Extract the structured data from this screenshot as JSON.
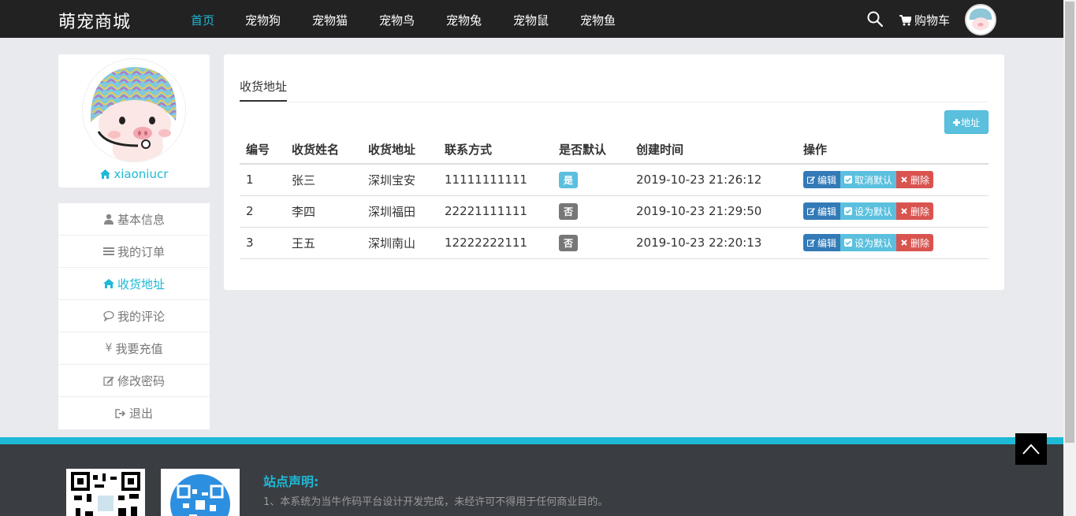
{
  "navbar": {
    "brand": "萌宠商城",
    "items": [
      "首页",
      "宠物狗",
      "宠物猫",
      "宠物鸟",
      "宠物兔",
      "宠物鼠",
      "宠物鱼"
    ],
    "cart_label": "购物车"
  },
  "profile": {
    "username": "xiaoniucr"
  },
  "side_menu": [
    {
      "label": "基本信息",
      "icon": "user-icon"
    },
    {
      "label": "我的订单",
      "icon": "list-icon"
    },
    {
      "label": "收货地址",
      "icon": "home-icon"
    },
    {
      "label": "我的评论",
      "icon": "comment-icon"
    },
    {
      "label": "我要充值",
      "icon": "yen-icon"
    },
    {
      "label": "修改密码",
      "icon": "edit-icon"
    },
    {
      "label": "退出",
      "icon": "signout-icon"
    }
  ],
  "main": {
    "tab_label": "收货地址",
    "add_button": "地址",
    "table": {
      "headers": [
        "编号",
        "收货姓名",
        "收货地址",
        "联系方式",
        "是否默认",
        "创建时间",
        "操作"
      ],
      "rows": [
        {
          "id": "1",
          "name": "张三",
          "address": "深圳宝安",
          "phone": "11111111111",
          "default": "是",
          "created": "2019-10-23 21:26:12",
          "default_action": "取消默认"
        },
        {
          "id": "2",
          "name": "李四",
          "address": "深圳福田",
          "phone": "22221111111",
          "default": "否",
          "created": "2019-10-23 21:29:50",
          "default_action": "设为默认"
        },
        {
          "id": "3",
          "name": "王五",
          "address": "深圳南山",
          "phone": "12222222111",
          "default": "否",
          "created": "2019-10-23 22:20:13",
          "default_action": "设为默认"
        }
      ],
      "edit_label": "编辑",
      "delete_label": "删除"
    }
  },
  "footer": {
    "title": "站点声明:",
    "text": "1、本系统为当牛作码平台设计开发完成，未经许可不得用于任何商业目的。"
  },
  "colors": {
    "accent": "#1eb9d5",
    "navbar": "#222222",
    "info": "#5bc0de",
    "primary": "#337ab7",
    "danger": "#d9534f"
  }
}
